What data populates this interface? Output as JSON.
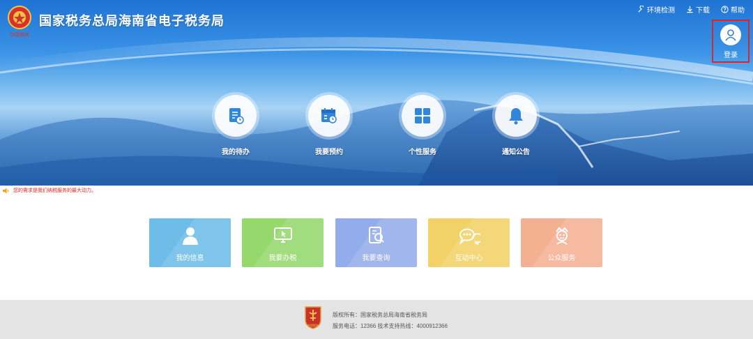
{
  "header": {
    "logo_text": "中国税务",
    "title": "国家税务总局海南省电子税务局",
    "links": [
      {
        "label": "环境检测",
        "icon": "wrench-icon"
      },
      {
        "label": "下载",
        "icon": "download-icon"
      },
      {
        "label": "帮助",
        "icon": "help-icon"
      }
    ],
    "login": {
      "label": "登录",
      "icon": "user-icon"
    }
  },
  "quick_entries": [
    {
      "label": "我的待办",
      "icon": "todo-icon"
    },
    {
      "label": "我要预约",
      "icon": "calendar-icon"
    },
    {
      "label": "个性服务",
      "icon": "grid-icon"
    },
    {
      "label": "通知公告",
      "icon": "bell-icon"
    }
  ],
  "notice": {
    "icon": "speaker-icon",
    "text": "您的需求是我们纳税服务的最大动力。"
  },
  "tiles": [
    {
      "label": "我的信息",
      "icon": "person-icon",
      "color": "#6ebde9"
    },
    {
      "label": "我要办税",
      "icon": "monitor-icon",
      "color": "#95d96d"
    },
    {
      "label": "我要查询",
      "icon": "search-doc-icon",
      "color": "#93aceb"
    },
    {
      "label": "互动中心",
      "icon": "chat-icon",
      "color": "#f2d266"
    },
    {
      "label": "公众服务",
      "icon": "service-icon",
      "color": "#f4b192"
    }
  ],
  "footer": {
    "copyright": "版权所有：国家税务总局海南省税务局",
    "contact": "服务电话：12366 技术支持热线：4000912366",
    "emblem_text": "中国税务"
  },
  "colors": {
    "header_blue": "#1f73d3",
    "login_highlight": "#d9262b",
    "notice_red": "#e0251d",
    "footer_bg": "#e4e4e4"
  }
}
